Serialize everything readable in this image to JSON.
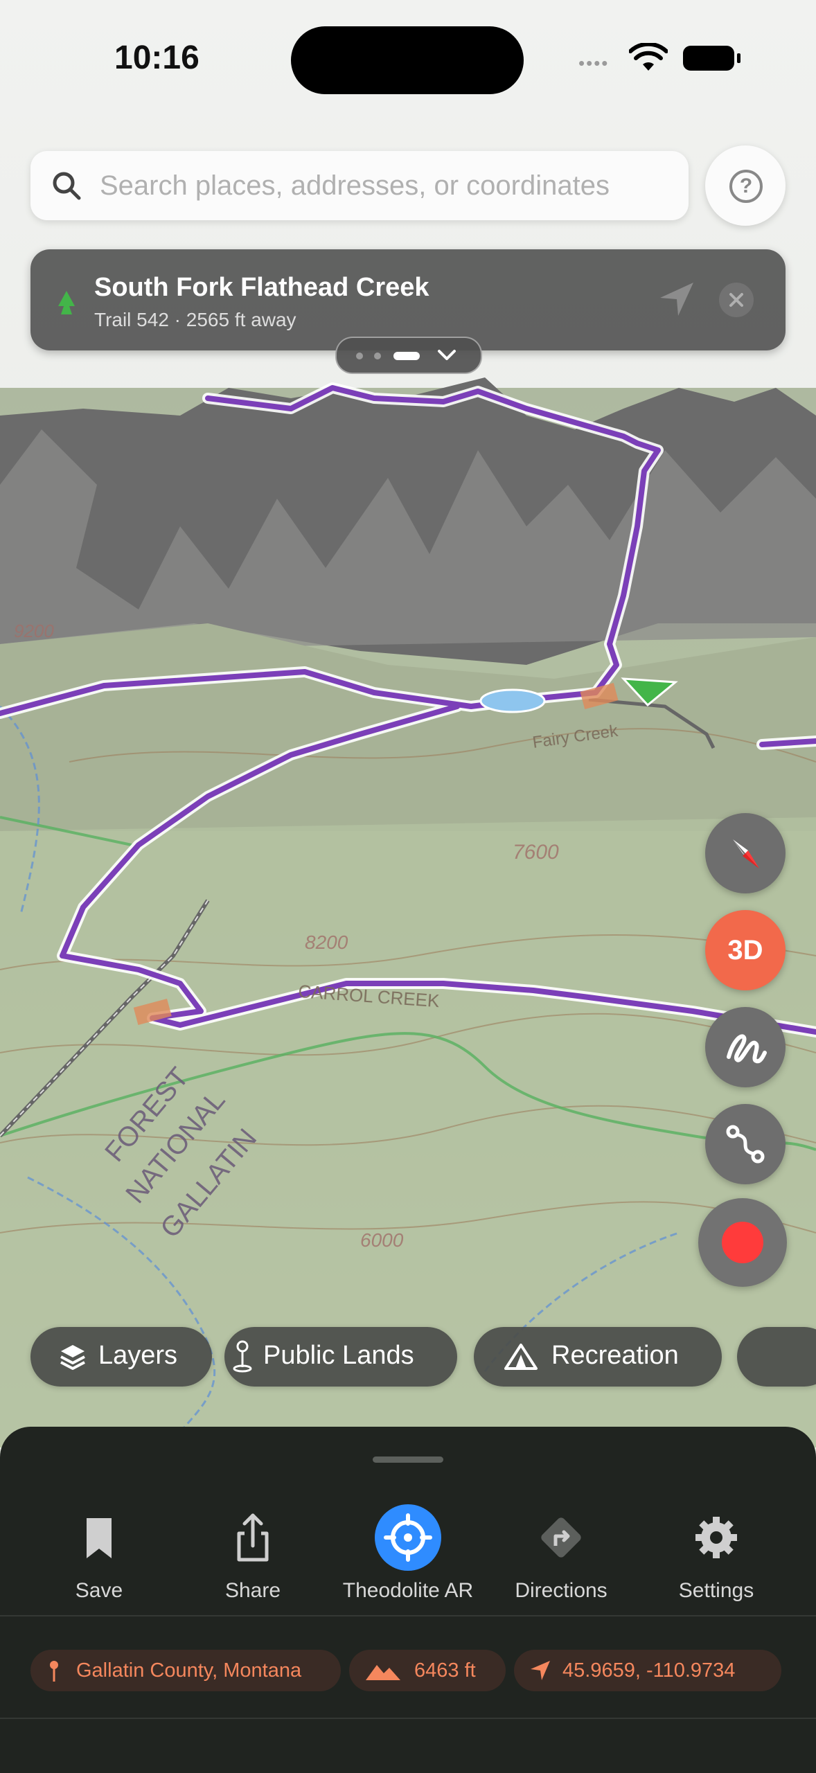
{
  "status": {
    "time": "10:16"
  },
  "search": {
    "placeholder": "Search places, addresses, or coordinates"
  },
  "trail_card": {
    "title": "South Fork Flathead Creek",
    "subtitle": "Trail 542 · 2565 ft away"
  },
  "map": {
    "labels": {
      "forest": [
        "GALLATIN",
        "NATIONAL",
        "FOREST"
      ],
      "creek": "CARROL CREEK",
      "fairy_creek": "Fairy Creek",
      "elev": [
        "7600",
        "8200",
        "6000",
        "9200"
      ]
    }
  },
  "controls": {
    "three_d": "3D"
  },
  "chips": [
    "Layers",
    "Public Lands",
    "Recreation"
  ],
  "actions": [
    {
      "label": "Save",
      "icon": "bookmark-icon"
    },
    {
      "label": "Share",
      "icon": "share-icon"
    },
    {
      "label": "Theodolite AR",
      "icon": "crosshair-icon"
    },
    {
      "label": "Directions",
      "icon": "directions-icon"
    },
    {
      "label": "Settings",
      "icon": "gear-icon"
    }
  ],
  "info": {
    "location": "Gallatin County, Montana",
    "elevation": "6463 ft",
    "coords": "45.9659, -110.9734"
  },
  "colors": {
    "accent": "#f2694b",
    "trail": "#7b3fb8",
    "ar_blue": "#2f8cff",
    "info_text": "#f5875d"
  }
}
